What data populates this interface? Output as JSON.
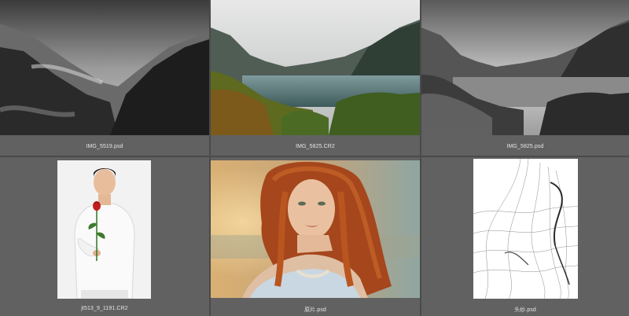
{
  "thumbnails": [
    {
      "filename": "IMG_5519.psd",
      "subject": "black-and-white misty mountain valley with forest"
    },
    {
      "filename": "IMG_5825.CR2",
      "subject": "color lake surrounded by forested mountains in fog"
    },
    {
      "filename": "IMG_5825.psd",
      "subject": "black-and-white lake with forested mountains in fog"
    },
    {
      "filename": "jt513_9_1191.CR2",
      "subject": "man in white shirt holding a red rose"
    },
    {
      "filename": "原片.psd",
      "subject": "red-haired woman portrait at sunset"
    },
    {
      "filename": "头纱.psd",
      "subject": "flowing sheer veil fabric on white"
    }
  ],
  "colors": {
    "background": "#4a4a4a",
    "cell": "#616161",
    "label_text": "#e6e6e6"
  }
}
